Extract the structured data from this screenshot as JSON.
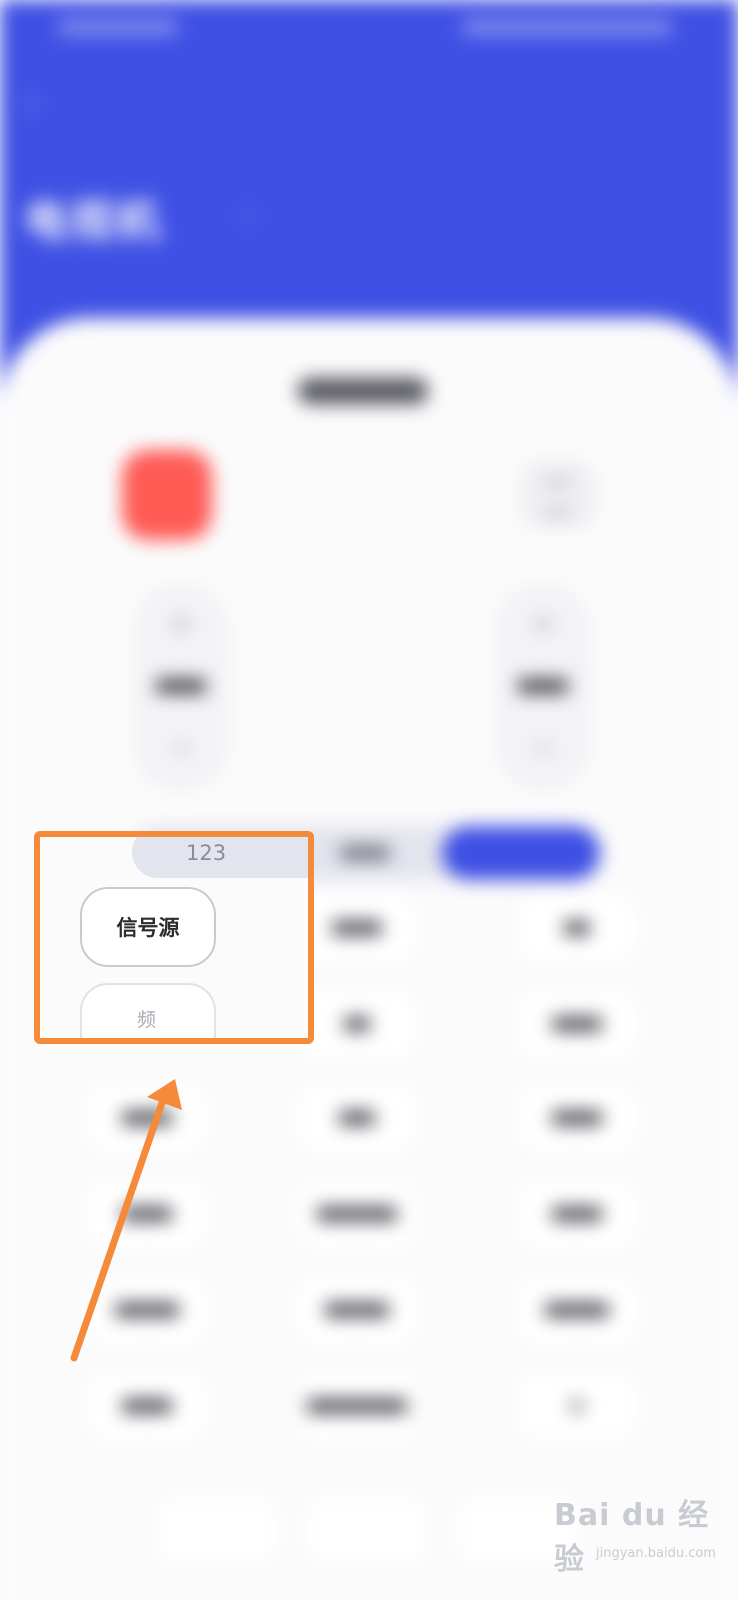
{
  "screen": {
    "title": "电视机",
    "segmented_control": {
      "visible_label": "123"
    },
    "focused_buttons": {
      "signal_source": "信号源",
      "next_partial": "频"
    }
  },
  "annotation": {
    "highlight_color": "#f58b3a",
    "arrow_color": "#f58b3a"
  },
  "watermark": {
    "brand": "Bai du 经验",
    "url": "jingyan.baidu.com"
  },
  "colors": {
    "header": "#3f50e4",
    "power": "#ff5b55"
  }
}
